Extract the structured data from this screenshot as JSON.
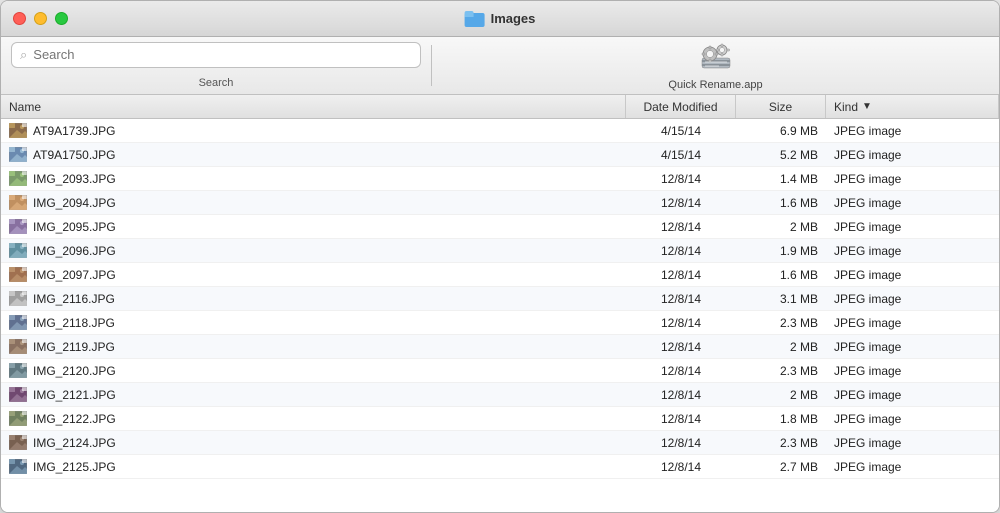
{
  "window": {
    "title": "Images"
  },
  "toolbar": {
    "search_placeholder": "Search",
    "search_label": "Search",
    "app_label": "Quick Rename.app"
  },
  "columns": {
    "name": "Name",
    "date": "Date Modified",
    "size": "Size",
    "kind": "Kind",
    "sort_arrow": "▼"
  },
  "files": [
    {
      "name": "AT9A1739.JPG",
      "date": "4/15/14",
      "size": "6.9 MB",
      "kind": "JPEG image"
    },
    {
      "name": "AT9A1750.JPG",
      "date": "4/15/14",
      "size": "5.2 MB",
      "kind": "JPEG image"
    },
    {
      "name": "IMG_2093.JPG",
      "date": "12/8/14",
      "size": "1.4 MB",
      "kind": "JPEG image"
    },
    {
      "name": "IMG_2094.JPG",
      "date": "12/8/14",
      "size": "1.6 MB",
      "kind": "JPEG image"
    },
    {
      "name": "IMG_2095.JPG",
      "date": "12/8/14",
      "size": "2 MB",
      "kind": "JPEG image"
    },
    {
      "name": "IMG_2096.JPG",
      "date": "12/8/14",
      "size": "1.9 MB",
      "kind": "JPEG image"
    },
    {
      "name": "IMG_2097.JPG",
      "date": "12/8/14",
      "size": "1.6 MB",
      "kind": "JPEG image"
    },
    {
      "name": "IMG_2116.JPG",
      "date": "12/8/14",
      "size": "3.1 MB",
      "kind": "JPEG image"
    },
    {
      "name": "IMG_2118.JPG",
      "date": "12/8/14",
      "size": "2.3 MB",
      "kind": "JPEG image"
    },
    {
      "name": "IMG_2119.JPG",
      "date": "12/8/14",
      "size": "2 MB",
      "kind": "JPEG image"
    },
    {
      "name": "IMG_2120.JPG",
      "date": "12/8/14",
      "size": "2.3 MB",
      "kind": "JPEG image"
    },
    {
      "name": "IMG_2121.JPG",
      "date": "12/8/14",
      "size": "2 MB",
      "kind": "JPEG image"
    },
    {
      "name": "IMG_2122.JPG",
      "date": "12/8/14",
      "size": "1.8 MB",
      "kind": "JPEG image"
    },
    {
      "name": "IMG_2124.JPG",
      "date": "12/8/14",
      "size": "2.3 MB",
      "kind": "JPEG image"
    },
    {
      "name": "IMG_2125.JPG",
      "date": "12/8/14",
      "size": "2.7 MB",
      "kind": "JPEG image"
    }
  ]
}
